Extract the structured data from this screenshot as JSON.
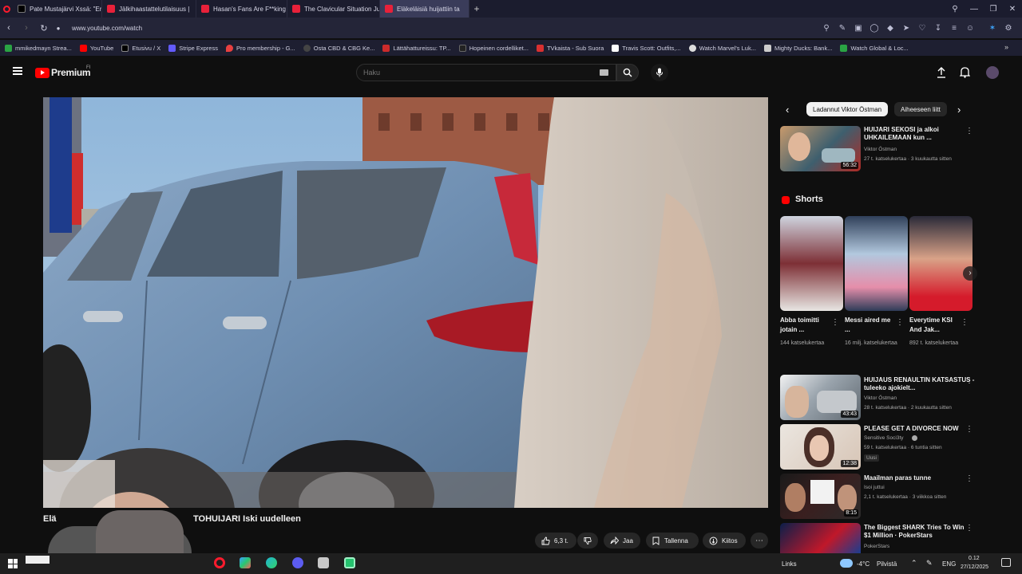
{
  "browser": {
    "tabs": [
      {
        "label": "Pate Mustajärvi Xssä: \"En",
        "icon": "x-logo-icon"
      },
      {
        "label": "Jälkihaastattelutilaisuus |",
        "icon": "youtube-icon"
      },
      {
        "label": "Hasan's Fans Are F**king",
        "icon": "youtube-icon"
      },
      {
        "label": "The Clavicular Situation Ju",
        "icon": "youtube-icon"
      },
      {
        "label": "Eläkeläisiä huijattiin ta",
        "icon": "youtube-icon",
        "active": true
      }
    ],
    "url": "www.youtube.com/watch",
    "bookmarks": [
      {
        "label": "mmikedmayn Strea...",
        "color": "#2aa344"
      },
      {
        "label": "YouTube",
        "color": "#ff0000"
      },
      {
        "label": "Etusivu / X",
        "color": "#000000"
      },
      {
        "label": "Stripe Express",
        "color": "#635bff"
      },
      {
        "label": "Pro membership - G...",
        "color": "#e84040"
      },
      {
        "label": "Osta CBD & CBG Ke...",
        "color": "#444444"
      },
      {
        "label": "Lättähattureissu: TP...",
        "color": "#cc2b2b"
      },
      {
        "label": "Hopeinen cordelliket...",
        "color": "#222222"
      },
      {
        "label": "TVkaista - Sub Suora",
        "color": "#d83030"
      },
      {
        "label": "Travis Scott: Outfits,...",
        "color": "#ffffff"
      },
      {
        "label": "Watch Marvel's Luk...",
        "color": "#dddddd"
      },
      {
        "label": "Mighty Ducks: Bank...",
        "color": "#cccccc"
      },
      {
        "label": "Watch Global & Loc...",
        "color": "#2aa344"
      }
    ]
  },
  "youtube": {
    "brand": "Premium",
    "brand_sup": "FI",
    "search_placeholder": "Haku",
    "video_title_left": "Elä",
    "video_title": "TOHUIJARI Iski uudelleen",
    "actions": {
      "likes": "6,3 t.",
      "share": "Jaa",
      "save": "Tallenna",
      "thanks": "Kiitos"
    },
    "chips": [
      "Ladannut Viktor Östman",
      "Aiheeseen liitt"
    ],
    "shorts_heading": "Shorts",
    "recommended": [
      {
        "title": "HUIJARI SEKOSI ja alkoi UHKAILEMAAN kun ...",
        "channel": "Viktor Östman",
        "meta": "27 t. katselukertaa · 3 kuukautta sitten",
        "duration": "56:32"
      },
      {
        "title": "HUIJAUS RENAULTIN KATSASTUS - tuleeko ajokielt...",
        "channel": "Viktor Östman",
        "meta": "28 t. katselukertaa · 2 kuukautta sitten",
        "duration": "43:43"
      },
      {
        "title": "PLEASE GET A DIVORCE NOW",
        "channel": "Sensitive Soci3ty",
        "meta": "59 t. katselukertaa · 6 tuntia sitten",
        "badge": "Uusi",
        "duration": "12:38"
      },
      {
        "title": "Maailman paras tunne",
        "channel": "Isoi juttui",
        "meta": "2,1 t. katselukertaa · 3 viikkoa sitten",
        "duration": "8:15"
      },
      {
        "title": "The Biggest SHARK Tries To Win $1 Million · PokerStars",
        "channel": "PokerStars",
        "meta": "",
        "duration": ""
      }
    ],
    "shorts": [
      {
        "title": "Abba toimitti jotain ...",
        "views": "144 katselukertaa"
      },
      {
        "title": "Messi aired me ...",
        "views": "16 milj. katselukertaa"
      },
      {
        "title": "Everytime KSI And Jak...",
        "views": "892 t. katselukertaa"
      }
    ]
  },
  "taskbar": {
    "links": "Links",
    "weather": "-4°C",
    "weather_desc": "Pilvistä",
    "lang": "ENG",
    "time": "0.12",
    "date": "27/12/2025"
  }
}
